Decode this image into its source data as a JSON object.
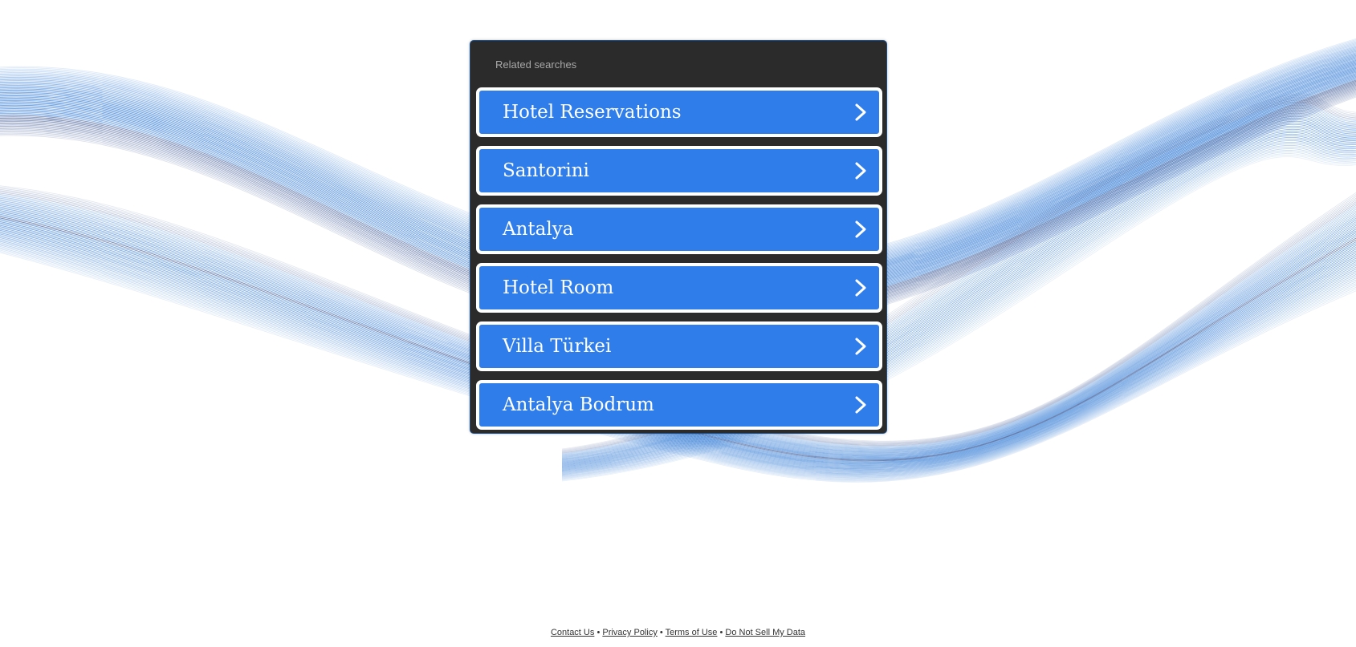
{
  "related_searches": {
    "title": "Related searches",
    "items": [
      {
        "label": "Hotel Reservations"
      },
      {
        "label": "Santorini"
      },
      {
        "label": "Antalya"
      },
      {
        "label": "Hotel Room"
      },
      {
        "label": "Villa Türkei"
      },
      {
        "label": "Antalya Bodrum"
      }
    ],
    "arrow_icon": "chevron-right-icon"
  },
  "footer": {
    "links": [
      "Contact Us",
      "Privacy Policy",
      "Terms of Use",
      "Do Not Sell My Data"
    ],
    "separator": "•"
  },
  "colors": {
    "panel_background": "#2b2b2b",
    "item_background": "#2f7deb",
    "item_border": "#ffffff",
    "wave_blue": "#1f6fd1",
    "wave_dark": "#0c2e7a"
  }
}
